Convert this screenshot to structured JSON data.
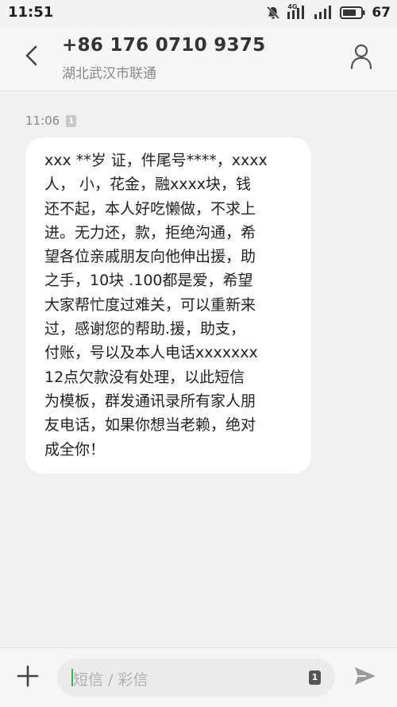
{
  "status_bar": {
    "time": "11:51",
    "network_label": "4G",
    "battery_percent": "67",
    "icons": [
      "notifications-muted-icon",
      "signal-4g-icon",
      "signal-icon",
      "battery-icon"
    ]
  },
  "header": {
    "contact_number": "+86 176 0710 9375",
    "contact_location": "湖北武汉市联通",
    "back_icon": "chevron-left-icon",
    "contact_icon": "person-icon"
  },
  "conversation": {
    "timestamp": "11:06",
    "sim_label": "1",
    "message_lines": [
      "xxx  **岁 证，件尾号****，xxxx",
      "人，  小，花金，融xxxx块，钱",
      "还不起，本人好吃懒做，不求上",
      "进。无力还，款，拒绝沟通，希",
      "望各位亲戚朋友向他伸出援，助",
      "之手，10块 .100都是爱，希望",
      "大家帮忙度过难关，可以重新来",
      "过，感谢您的帮助.援，助支，",
      "付账，号以及本人电话xxxxxxx",
      "12点欠款没有处理，以此短信",
      "为模板，群发通讯录所有家人朋",
      "友电话，如果你想当老赖，绝对",
      "成全你！"
    ]
  },
  "input_bar": {
    "placeholder": "短信 / 彩信",
    "sim_label": "1",
    "add_icon": "plus-icon",
    "send_icon": "send-icon"
  },
  "colors": {
    "background": "#f0f0f0",
    "bubble": "#ffffff",
    "caret": "#3bb34a"
  }
}
